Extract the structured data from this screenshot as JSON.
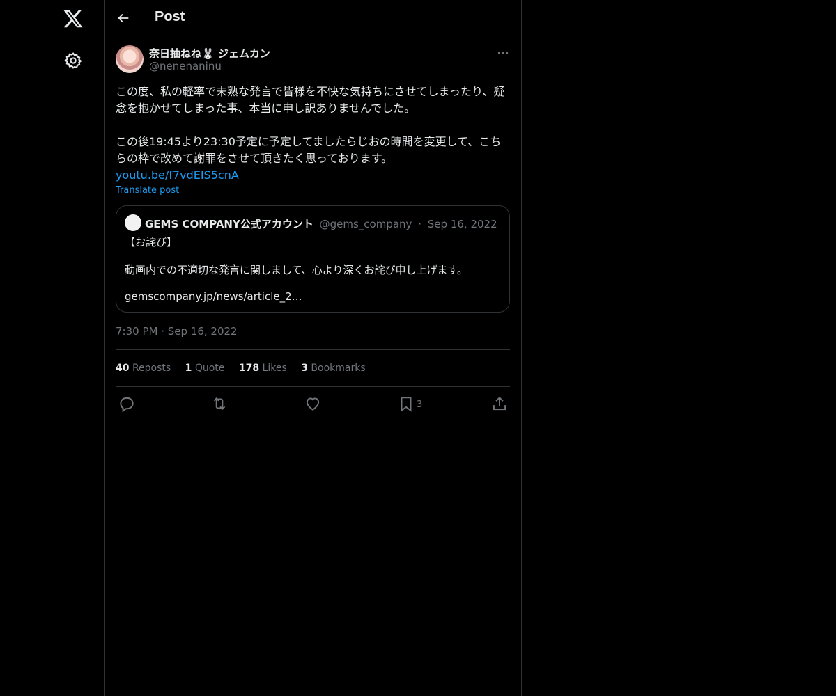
{
  "colors": {
    "background": "#000000",
    "text": "#e7e9ea",
    "muted": "#71767b",
    "link": "#1d9bf0",
    "border": "#2f3336"
  },
  "nav": {
    "logo_icon": "x-logo-icon",
    "settings_icon": "gear-icon"
  },
  "header": {
    "title": "Post",
    "back_icon": "arrow-left-icon"
  },
  "post": {
    "author": {
      "name": "奈日抽ねね🐰 ジェムカン",
      "handle": "@nenenaninu"
    },
    "more_icon": "more-dots-icon",
    "text_paragraph1": "この度、私の軽率で未熟な発言で皆様を不快な気持ちにさせてしまったり、疑念を抱かせてしまった事、本当に申し訳ありませんでした。",
    "text_paragraph2": "この後19:45より23:30予定に予定してましたらじおの時間を変更して、こちらの枠で改めて謝罪をさせて頂きたく思っております。",
    "link_text": "youtu.be/f7vdEIS5cnA",
    "translate_label": "Translate post",
    "quote": {
      "name": "GEMS COMPANY公式アカウント",
      "handle": "@gems_company",
      "separator": "·",
      "date": "Sep 16, 2022",
      "line1": "【お詫び】",
      "line2": "動画内での不適切な発言に関しまして、心より深くお詫び申し上げます。",
      "line3": "gemscompany.jp/news/article_2…"
    },
    "timestamp": "7:30 PM · Sep 16, 2022",
    "stats": {
      "reposts_count": "40",
      "reposts_label": "Reposts",
      "quote_count": "1",
      "quote_label": "Quote",
      "likes_count": "178",
      "likes_label": "Likes",
      "bookmarks_count": "3",
      "bookmarks_label": "Bookmarks"
    },
    "actions": {
      "reply_icon": "reply-icon",
      "repost_icon": "repost-icon",
      "like_icon": "heart-icon",
      "bookmark_icon": "bookmark-icon",
      "bookmark_count": "3",
      "share_icon": "share-icon"
    }
  }
}
